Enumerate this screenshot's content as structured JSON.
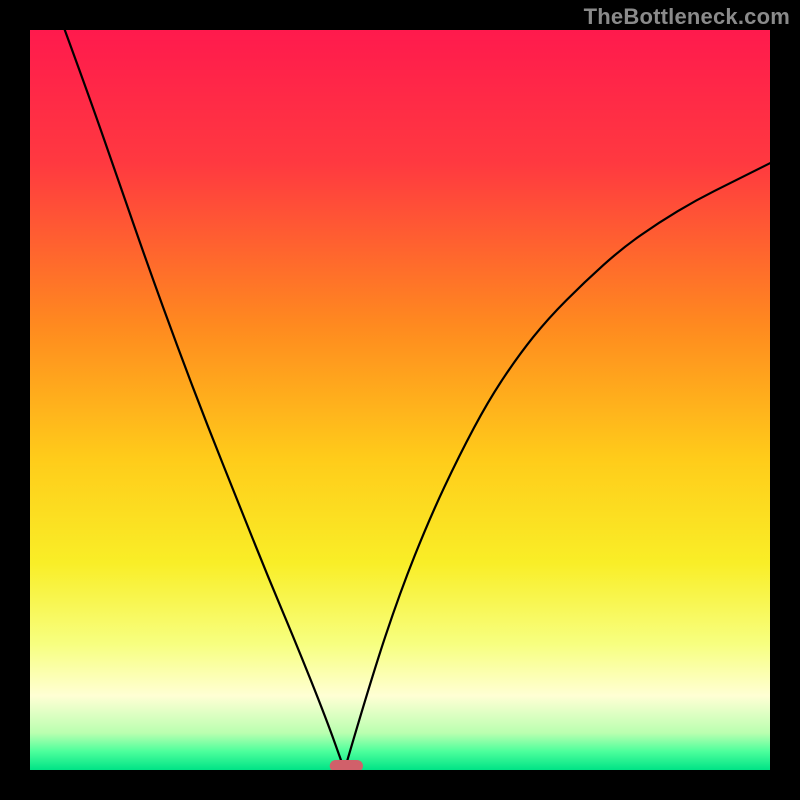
{
  "watermark": "TheBottleneck.com",
  "chart_data": {
    "type": "line",
    "title": "",
    "xlabel": "",
    "ylabel": "",
    "xlim": [
      0,
      100
    ],
    "ylim": [
      0,
      100
    ],
    "gradient_stops": [
      {
        "offset": 0.0,
        "color": "#ff1a4d"
      },
      {
        "offset": 0.18,
        "color": "#ff3940"
      },
      {
        "offset": 0.4,
        "color": "#ff8a1f"
      },
      {
        "offset": 0.58,
        "color": "#ffcc1a"
      },
      {
        "offset": 0.72,
        "color": "#f9ee27"
      },
      {
        "offset": 0.83,
        "color": "#f7ff80"
      },
      {
        "offset": 0.9,
        "color": "#ffffd4"
      },
      {
        "offset": 0.95,
        "color": "#baffb0"
      },
      {
        "offset": 0.975,
        "color": "#4cff9c"
      },
      {
        "offset": 1.0,
        "color": "#00e386"
      }
    ],
    "optimum_x": 42.5,
    "optimum_marker": {
      "x_start": 40.5,
      "x_end": 45.0,
      "color": "#d1606a"
    },
    "series": [
      {
        "name": "left-curve",
        "x": [
          4.7,
          8.0,
          12.0,
          16.0,
          20.0,
          24.0,
          28.0,
          32.0,
          36.0,
          40.0,
          42.5
        ],
        "y": [
          100.0,
          91.0,
          79.5,
          68.0,
          57.0,
          46.5,
          36.5,
          26.5,
          17.0,
          7.0,
          0.0
        ]
      },
      {
        "name": "right-curve",
        "x": [
          42.5,
          46.0,
          50.0,
          54.0,
          58.0,
          62.0,
          66.0,
          70.0,
          75.0,
          80.0,
          85.0,
          90.0,
          95.0,
          100.0
        ],
        "y": [
          0.0,
          12.0,
          24.0,
          34.0,
          42.5,
          50.0,
          56.0,
          61.0,
          66.0,
          70.5,
          74.0,
          77.0,
          79.5,
          82.0
        ]
      }
    ]
  }
}
